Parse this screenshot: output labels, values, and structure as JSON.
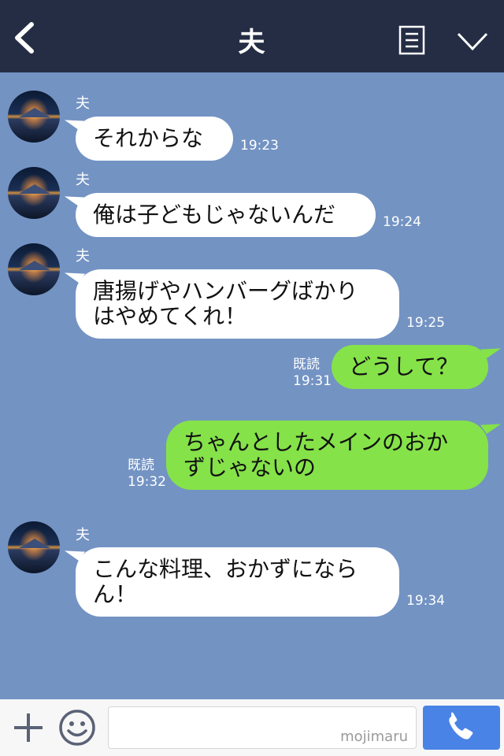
{
  "header": {
    "title": "夫",
    "back_icon": "chevron-left-icon",
    "menu_icon": "note-list-icon",
    "collapse_icon": "chevron-down-icon"
  },
  "messages": [
    {
      "side": "left",
      "sender": "夫",
      "text": "それからな",
      "time": "19:23"
    },
    {
      "side": "left",
      "sender": "夫",
      "text": "俺は子どもじゃないんだ",
      "time": "19:24"
    },
    {
      "side": "left",
      "sender": "夫",
      "lines": [
        "唐揚げやハンバーグばかり",
        "はやめてくれ！"
      ],
      "time": "19:25"
    },
    {
      "side": "right",
      "text": "どうして？",
      "read": "既読",
      "time": "19:31"
    },
    {
      "side": "right",
      "lines": [
        "ちゃんとしたメインのおか",
        "ずじゃないの"
      ],
      "read": "既読",
      "time": "19:32"
    },
    {
      "side": "left",
      "sender": "夫",
      "lines": [
        "こんな料理、おかずになら",
        "ん！"
      ],
      "time": "19:34"
    }
  ],
  "footer": {
    "plus_icon": "plus-icon",
    "emoji_icon": "smiley-icon",
    "input_value": "",
    "watermark": "mojimaru",
    "call_icon": "phone-icon"
  },
  "colors": {
    "background": "#7393c3",
    "header": "#252d45",
    "bubble_right": "#85e249",
    "bubble_left": "#ffffff",
    "call_button": "#4a83e6"
  }
}
